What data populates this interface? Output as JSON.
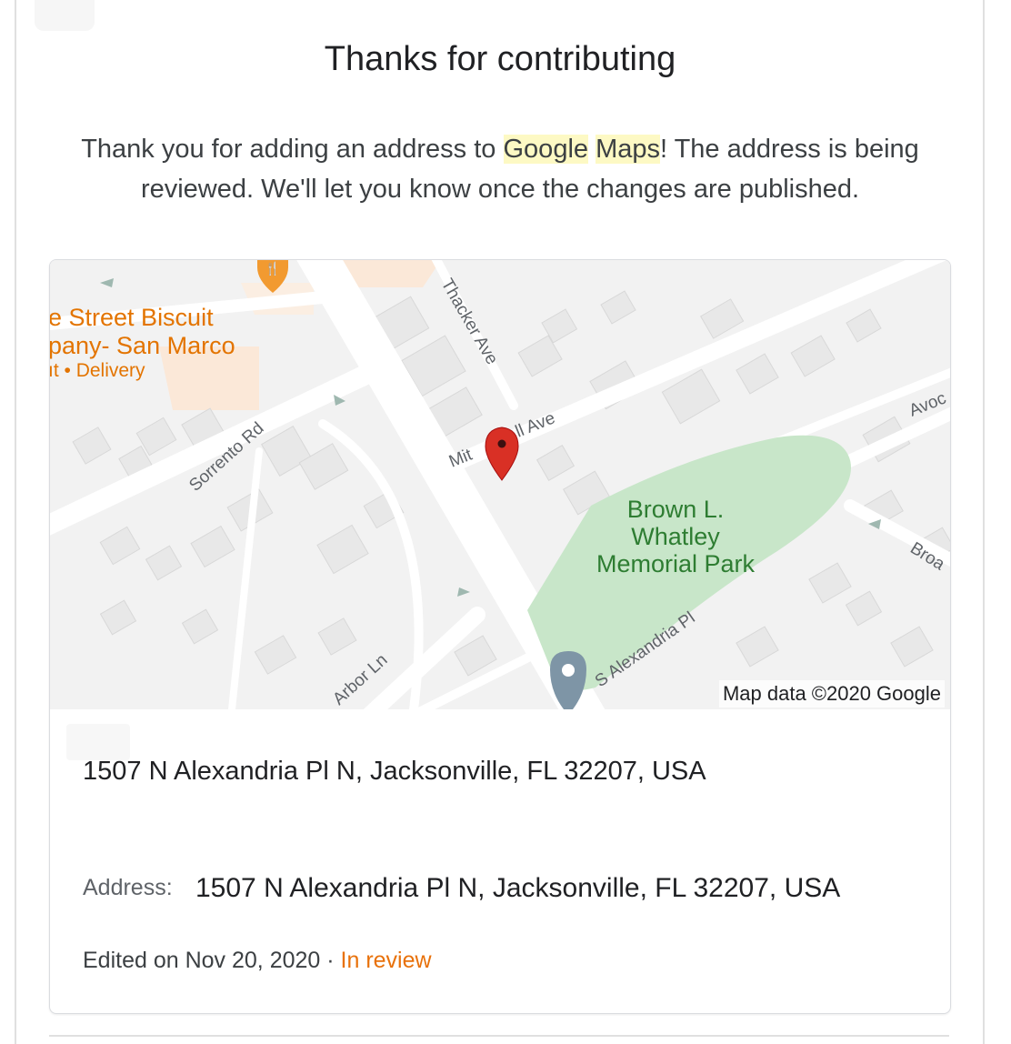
{
  "header": {
    "title": "Thanks for contributing",
    "message_before": "Thank you for adding an address to ",
    "message_highlight_1": "Google",
    "message_space": " ",
    "message_highlight_2": "Maps",
    "message_after": "! The address is being reviewed. We'll let you know once the changes are published."
  },
  "map": {
    "poi_name_line1": "e Street Biscuit",
    "poi_name_line2": "pany- San Marco",
    "poi_sub": "ıt • Delivery",
    "streets": {
      "thacker": "Thacker Ave",
      "mitchell_part1": "Mit",
      "mitchell_part2": "ll Ave",
      "sorrento": "Sorrento Rd",
      "arbor": "Arbor Ln",
      "s_alexandria": "S Alexandria Pl",
      "avoc": "Avoc",
      "broa": "Broa"
    },
    "park_line1": "Brown L.",
    "park_line2": "Whatley",
    "park_line3": "Memorial Park",
    "attribution": "Map data ©2020 Google",
    "marker_color": "#d93025",
    "park_color": "#c8e6c9",
    "icons": [
      "restaurant-pin-icon",
      "location-marker-icon",
      "place-pin-icon",
      "one-way-arrow-icon"
    ]
  },
  "card": {
    "address_heading": "1507 N Alexandria Pl N, Jacksonville, FL 32207, USA",
    "address_label": "Address:",
    "address_value": "1507 N Alexandria Pl N, Jacksonville, FL 32207, USA",
    "edited_text": "Edited on Nov 20, 2020 · ",
    "status_text": "In review",
    "status_color": "#e8710a"
  }
}
